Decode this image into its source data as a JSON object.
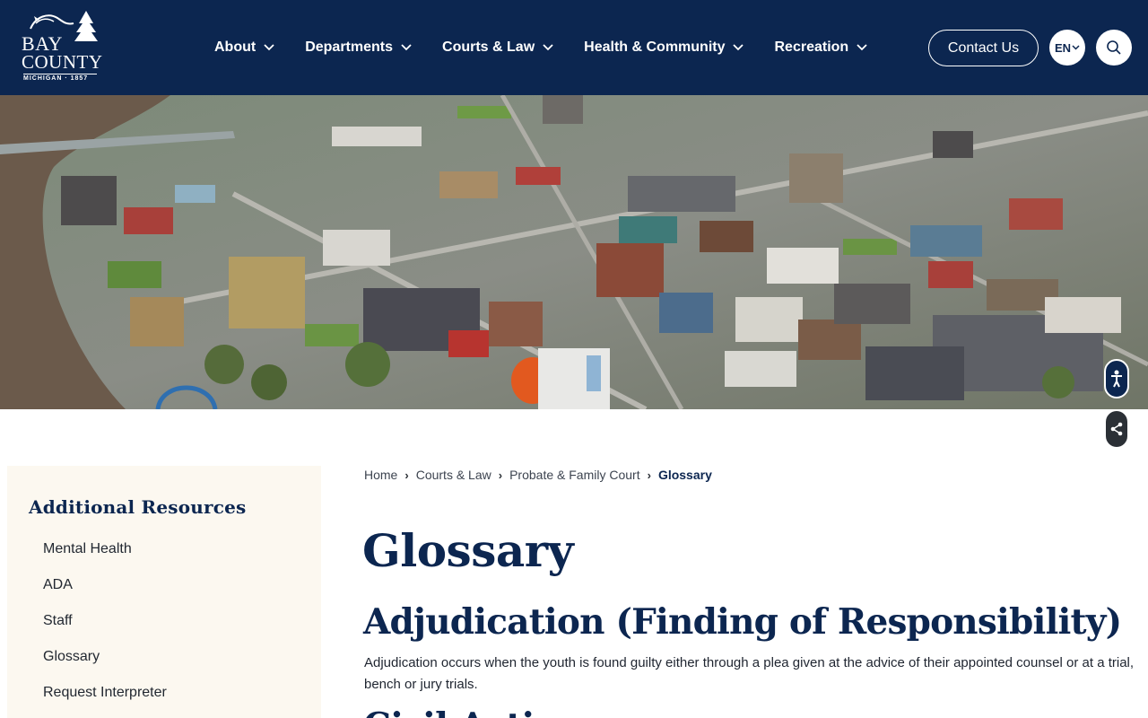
{
  "header": {
    "logo": {
      "line1": "BAY",
      "line2": "COUNTY",
      "sub": "MICHIGAN · 1857"
    },
    "nav": [
      {
        "label": "About",
        "icon": "chevron-down-icon"
      },
      {
        "label": "Departments",
        "icon": "chevron-down-icon"
      },
      {
        "label": "Courts & Law",
        "icon": "chevron-down-icon"
      },
      {
        "label": "Health & Community",
        "icon": "chevron-down-icon"
      },
      {
        "label": "Recreation",
        "icon": "chevron-down-icon"
      }
    ],
    "contact_label": "Contact Us",
    "language": "EN",
    "search_icon": "search-icon"
  },
  "hero": {
    "description_icon": "aerial-city-photo"
  },
  "floating": {
    "accessibility_icon": "accessibility-icon",
    "share_icon": "share-icon"
  },
  "sidebar": {
    "title": "Additional Resources",
    "items": [
      {
        "label": "Mental Health"
      },
      {
        "label": "ADA"
      },
      {
        "label": "Staff"
      },
      {
        "label": "Glossary"
      },
      {
        "label": "Request Interpreter"
      }
    ]
  },
  "breadcrumb": {
    "items": [
      "Home",
      "Courts & Law",
      "Probate & Family Court"
    ],
    "current": "Glossary"
  },
  "main": {
    "title": "Glossary",
    "terms": [
      {
        "term": "Adjudication (Finding of Responsibility)",
        "definition": "Adjudication occurs when the youth is found guilty either through a plea given at the advice of their appointed counsel or at a trial, bench or jury trials."
      },
      {
        "term": "Civil Action",
        "definition": ""
      }
    ]
  },
  "colors": {
    "navy": "#0c2650",
    "sidebar_bg": "#fcf8f0",
    "white": "#ffffff"
  }
}
